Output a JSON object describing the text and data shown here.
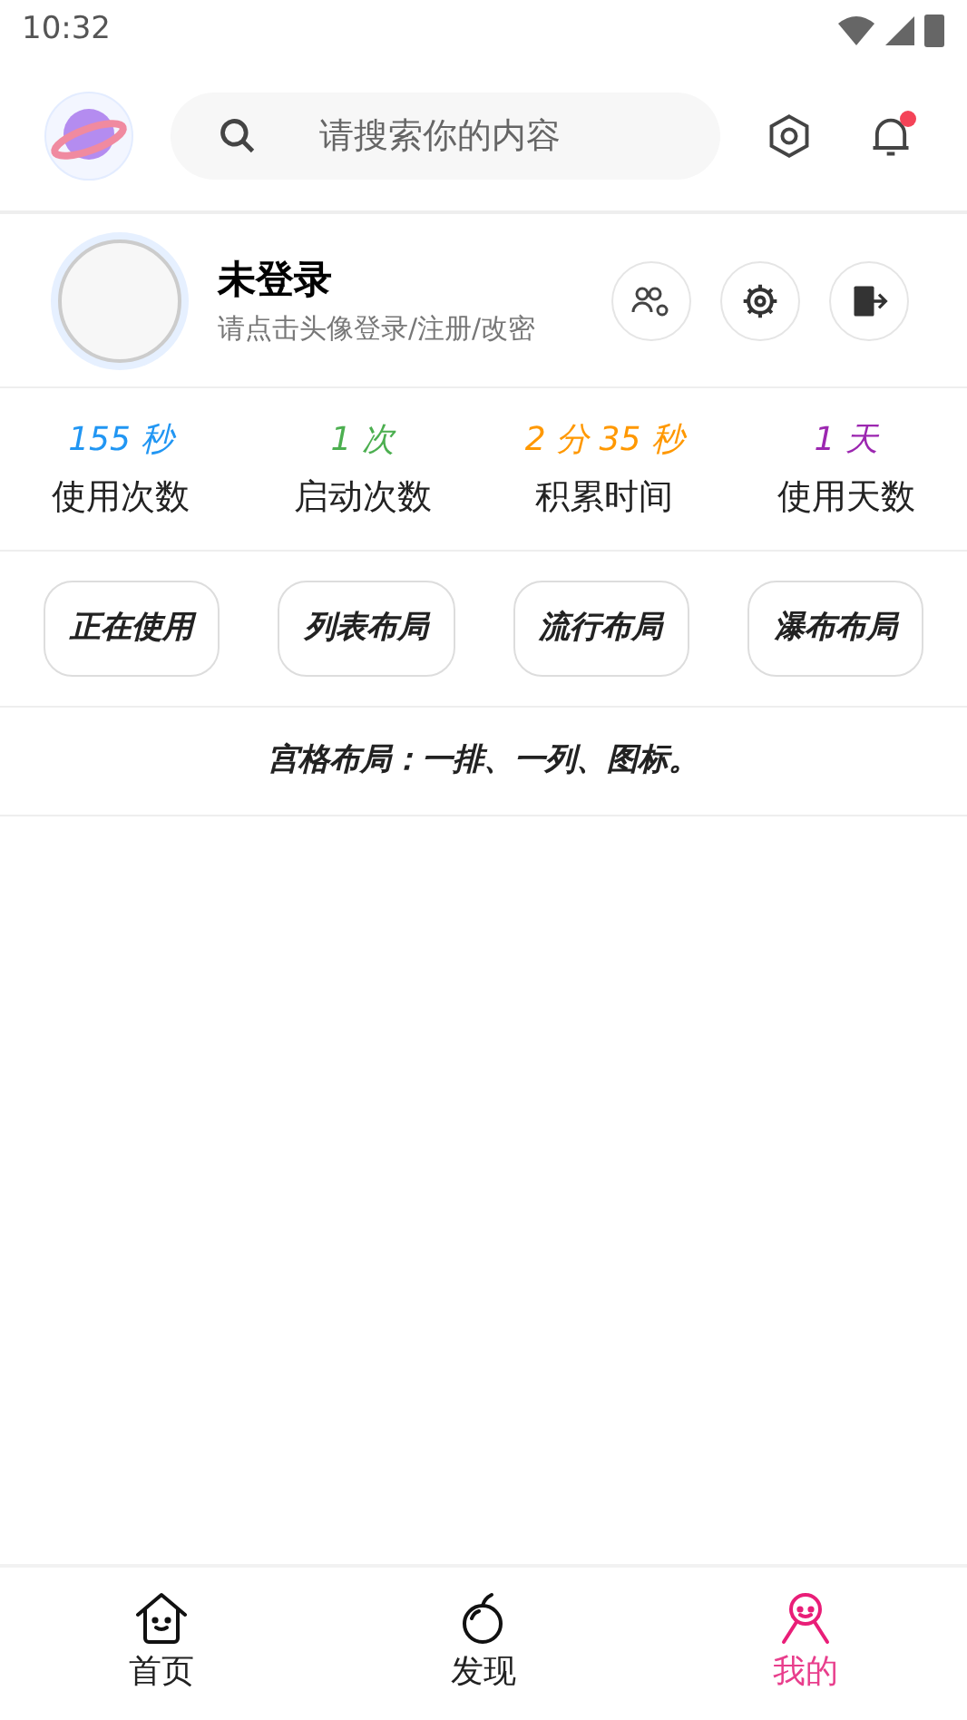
{
  "status_bar": {
    "time": "10:32"
  },
  "header": {
    "search": {
      "placeholder": "请搜索你的内容"
    },
    "notification_dot": true
  },
  "profile": {
    "name": "未登录",
    "hint": "请点击头像登录/注册/改密"
  },
  "stats": [
    {
      "value": "155 秒",
      "label": "使用次数",
      "color": "#2196f3"
    },
    {
      "value": "1 次",
      "label": "启动次数",
      "color": "#4caf50"
    },
    {
      "value": "2 分 35 秒",
      "label": "积累时间",
      "color": "#ff9800"
    },
    {
      "value": "1 天",
      "label": "使用天数",
      "color": "#9c27b0"
    }
  ],
  "layout_buttons": [
    "正在使用",
    "列表布局",
    "流行布局",
    "瀑布布局"
  ],
  "note": "宫格布局：一排、一列、图标。",
  "tabs": [
    {
      "label": "首页",
      "kind": "home",
      "selected": false
    },
    {
      "label": "发现",
      "kind": "fruit",
      "selected": false
    },
    {
      "label": "我的",
      "kind": "person",
      "selected": true
    }
  ]
}
